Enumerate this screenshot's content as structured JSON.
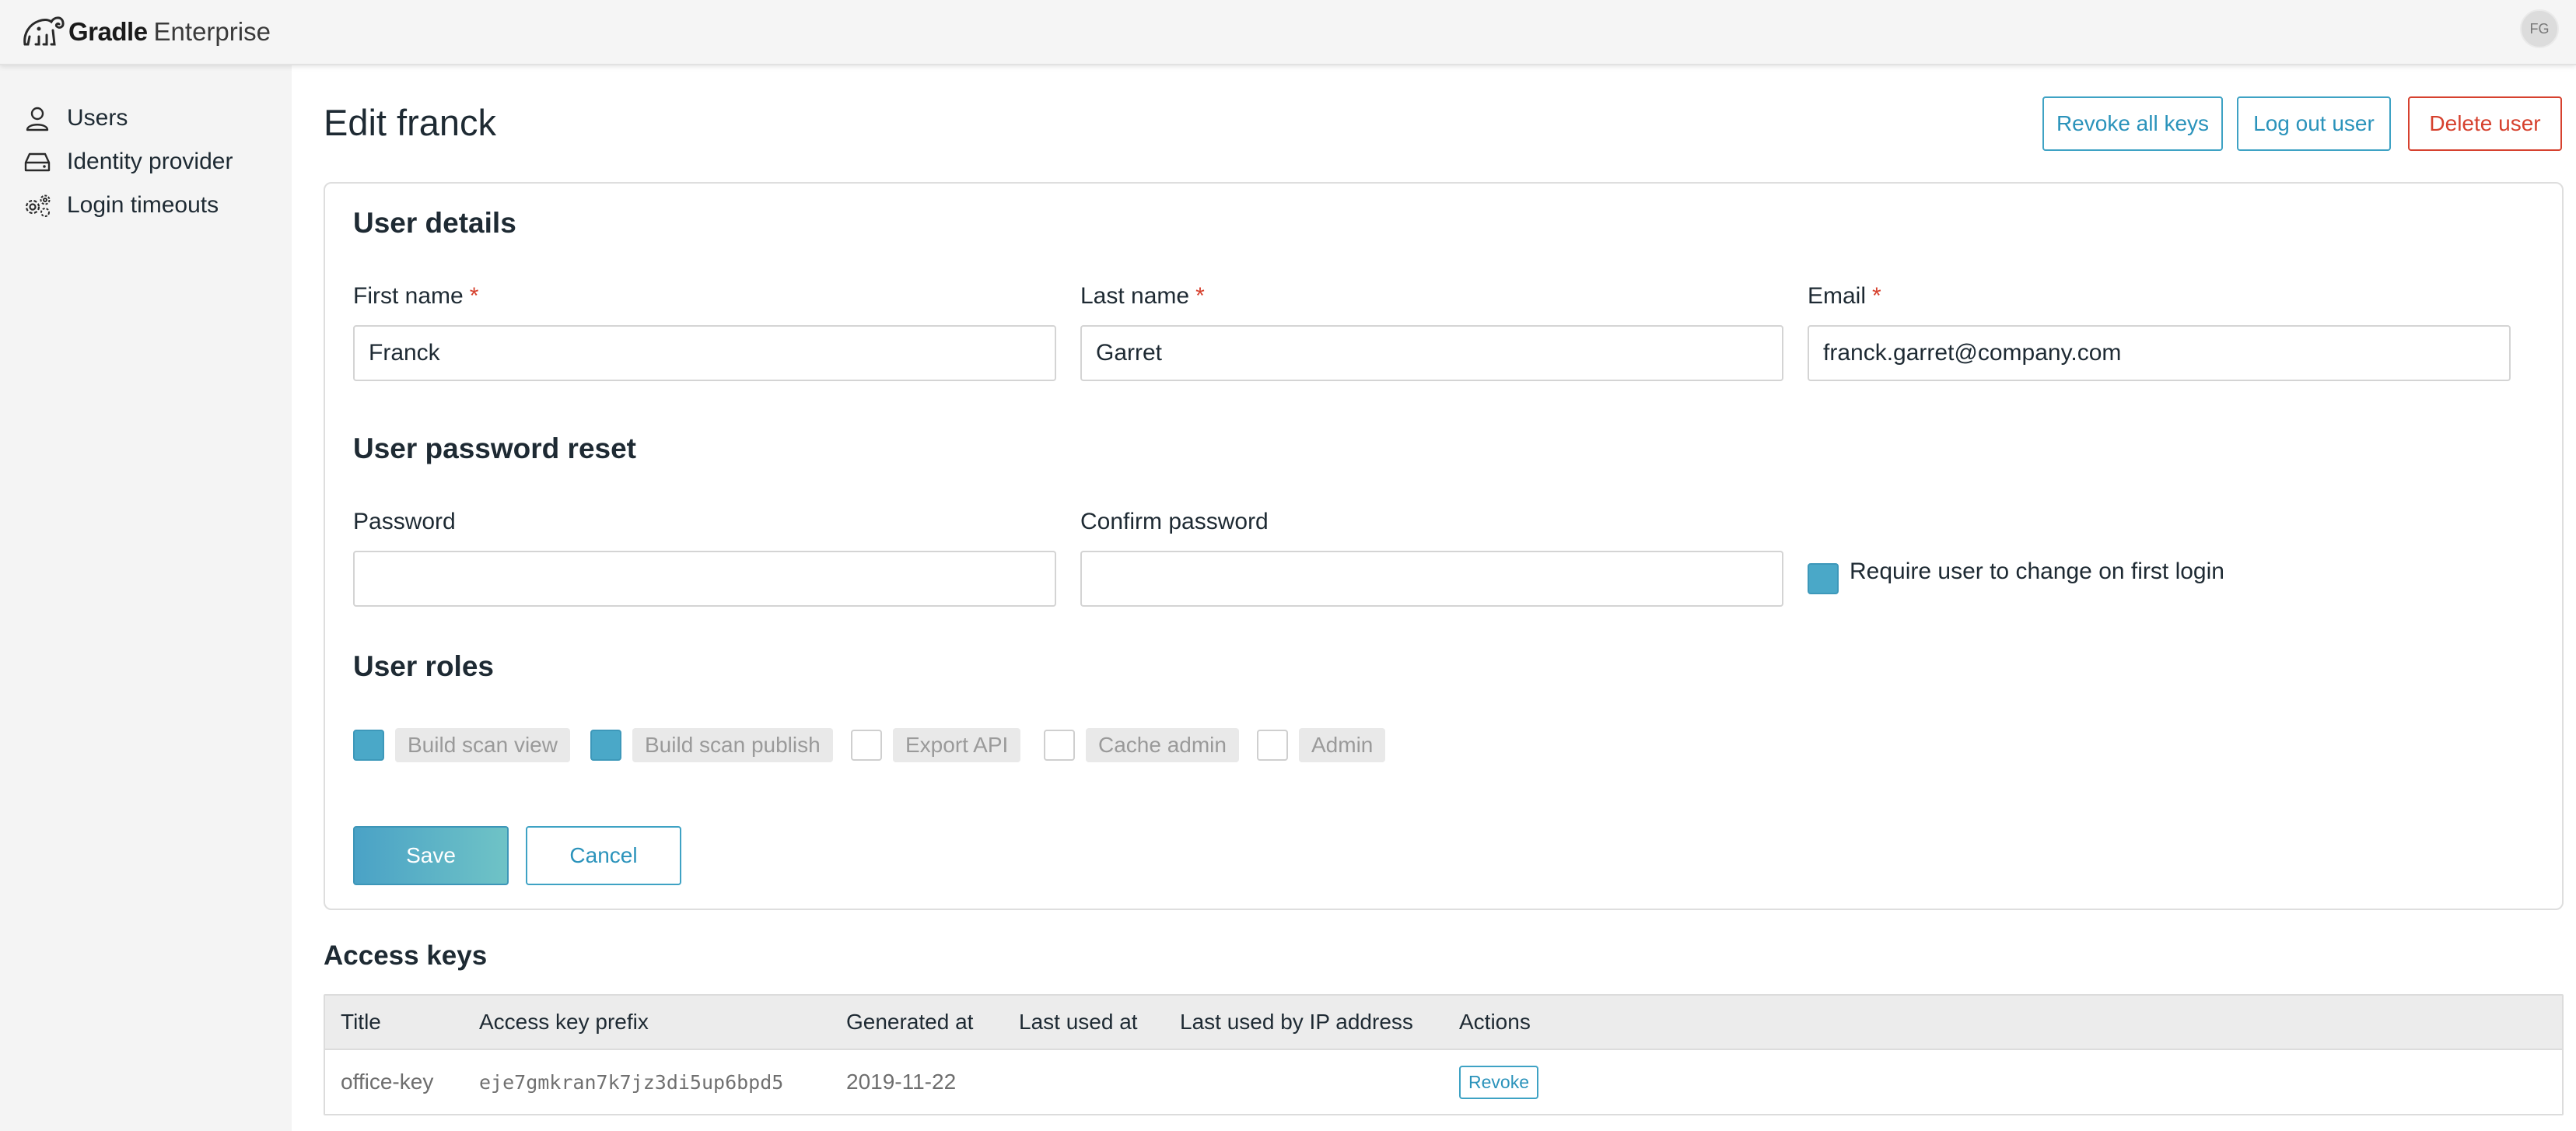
{
  "app": {
    "brand_bold": "Gradle",
    "brand_light": "Enterprise",
    "avatar_initials": "FG"
  },
  "sidebar": {
    "items": [
      {
        "label": "Users",
        "icon": "user-icon"
      },
      {
        "label": "Identity provider",
        "icon": "identity-provider-icon"
      },
      {
        "label": "Login timeouts",
        "icon": "gears-icon"
      }
    ]
  },
  "page": {
    "title": "Edit franck"
  },
  "header_actions": {
    "revoke_all_keys": "Revoke all keys",
    "log_out_user": "Log out user",
    "delete_user": "Delete user"
  },
  "user_details": {
    "title": "User details",
    "first_name": {
      "label": "First name",
      "required_mark": "*",
      "value": "Franck"
    },
    "last_name": {
      "label": "Last name",
      "required_mark": "*",
      "value": "Garret"
    },
    "email": {
      "label": "Email",
      "required_mark": "*",
      "value": "franck.garret@company.com"
    }
  },
  "password_reset": {
    "title": "User password reset",
    "password_label": "Password",
    "password_value": "",
    "confirm_label": "Confirm password",
    "confirm_value": "",
    "require_change_label": "Require user to change on first login",
    "require_change_checked": true
  },
  "roles": {
    "title": "User roles",
    "items": [
      {
        "label": "Build scan view",
        "checked": true
      },
      {
        "label": "Build scan publish",
        "checked": true
      },
      {
        "label": "Export API",
        "checked": false
      },
      {
        "label": "Cache admin",
        "checked": false
      },
      {
        "label": "Admin",
        "checked": false
      }
    ]
  },
  "form_actions": {
    "save": "Save",
    "cancel": "Cancel"
  },
  "access_keys": {
    "title": "Access keys",
    "columns": [
      "Title",
      "Access key prefix",
      "Generated at",
      "Last used at",
      "Last used by IP address",
      "Actions"
    ],
    "rows": [
      {
        "title": "office-key",
        "prefix": "eje7gmkran7k7jz3di5up6bpd5",
        "generated_at": "2019-11-22",
        "last_used_at": "",
        "last_ip": "",
        "action": "Revoke"
      }
    ]
  },
  "colors": {
    "accent": "#3ea2c4",
    "danger": "#d6412e",
    "checkbox_on": "#4aa8c8",
    "sidebar_bg": "#f4f4f4"
  }
}
